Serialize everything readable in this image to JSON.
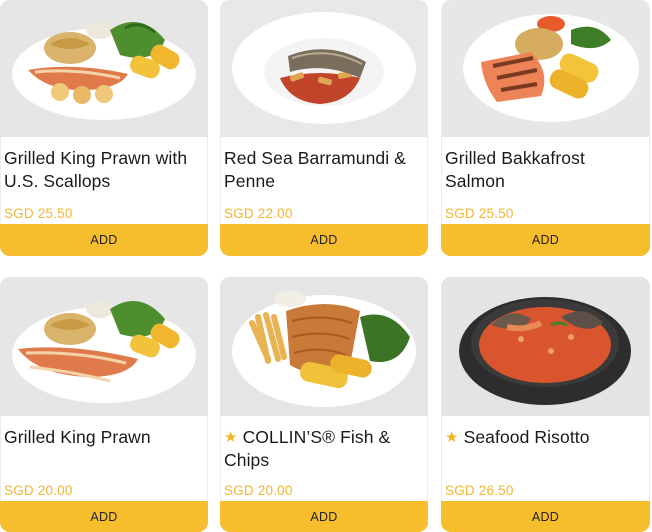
{
  "products": [
    {
      "name": "Grilled King Prawn with U.S. Scallops",
      "price": "SGD 25.50",
      "add_label": "ADD",
      "featured": false,
      "star": ""
    },
    {
      "name": "Red Sea Barramundi & Penne",
      "price": "SGD 22.00",
      "add_label": "ADD",
      "featured": false,
      "star": ""
    },
    {
      "name": "Grilled Bakkafrost Salmon",
      "price": "SGD 25.50",
      "add_label": "ADD",
      "featured": false,
      "star": ""
    },
    {
      "name": "Grilled King Prawn",
      "price": "SGD 20.00",
      "add_label": "ADD",
      "featured": false,
      "star": ""
    },
    {
      "name": "COLLIN’S® Fish & Chips",
      "price": "SGD 20.00",
      "add_label": "ADD",
      "featured": true,
      "star": "★"
    },
    {
      "name": "Seafood Risotto",
      "price": "SGD 26.50",
      "add_label": "ADD",
      "featured": true,
      "star": "★"
    }
  ],
  "colors": {
    "accent_button": "#f6be2c",
    "price_text": "#f2b531",
    "star": "#f3b623",
    "photo_background": "#e4e4e4"
  },
  "icons": {
    "featured": "star-icon"
  }
}
